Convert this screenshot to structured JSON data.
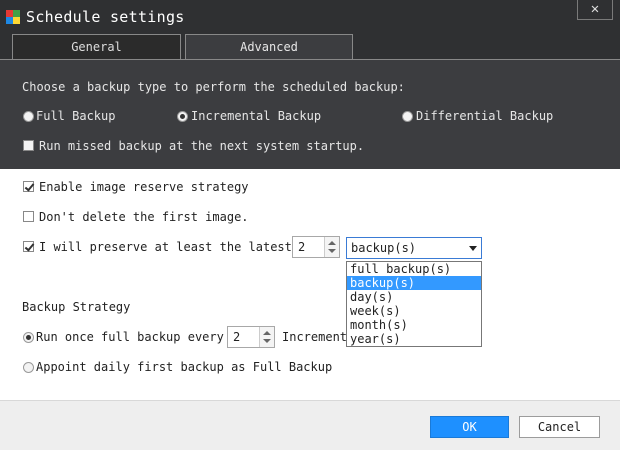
{
  "window": {
    "title": "Schedule settings",
    "close_glyph": "✕"
  },
  "tabs": [
    {
      "label": "General",
      "active": false
    },
    {
      "label": "Advanced",
      "active": true
    }
  ],
  "backup_type": {
    "prompt": "Choose a backup type to perform the scheduled backup:",
    "options": [
      {
        "label": "Full Backup",
        "selected": false
      },
      {
        "label": "Incremental Backup",
        "selected": true
      },
      {
        "label": "Differential Backup",
        "selected": false
      }
    ],
    "run_missed": {
      "label": "Run missed backup at the next system startup.",
      "checked": false
    }
  },
  "reserve": {
    "enable": {
      "label": "Enable image reserve strategy",
      "checked": true
    },
    "dont_delete": {
      "label": "Don't delete the first image.",
      "checked": false
    },
    "preserve": {
      "label": "I will preserve at least the latest",
      "checked": true,
      "count": "2"
    },
    "unit": {
      "selected": "backup(s)",
      "options": [
        "full backup(s)",
        "backup(s)",
        "day(s)",
        "week(s)",
        "month(s)",
        "year(s)"
      ],
      "highlighted_index": 1
    }
  },
  "strategy": {
    "heading": "Backup Strategy",
    "run_once": {
      "label": "Run once full backup every",
      "selected": true,
      "count": "2",
      "suffix": "Increment"
    },
    "appoint": {
      "label": "Appoint daily first backup as Full Backup",
      "selected": false
    }
  },
  "footer": {
    "ok_label": "OK",
    "cancel_label": "Cancel"
  },
  "colors": {
    "accent": "#1e90ff",
    "highlight": "#3399ff",
    "dark_bg": "#3c3d40"
  }
}
